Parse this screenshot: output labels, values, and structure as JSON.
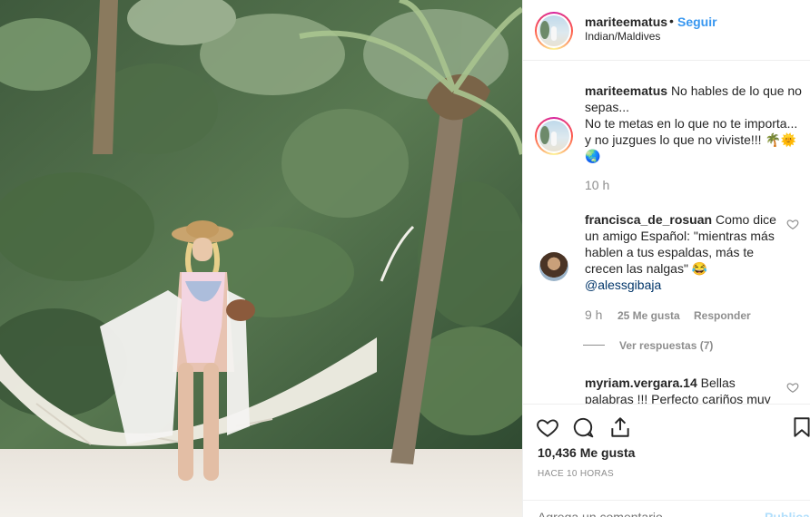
{
  "header": {
    "username": "mariteematus",
    "dot": "•",
    "follow_label": "Seguir",
    "location": "Indian/Maldives"
  },
  "caption": {
    "username": "mariteematus",
    "lines": [
      "No hables de lo que no",
      "sepas...",
      "No te metas en lo que no te importa...",
      "y no juzgues lo que no viviste!!! 🌴🌞",
      "🌏"
    ],
    "time": "10 h"
  },
  "comments": [
    {
      "username": "francisca_de_rosuan",
      "lines": [
        "Como dice",
        "un amigo Español: \"mientras más",
        "hablen a tus espaldas, más te",
        "crecen las nalgas\" 😂"
      ],
      "mention": "@alessgibaja",
      "time": "9 h",
      "likes": "25 Me gusta",
      "reply_label": "Responder",
      "view_replies": "Ver respuestas (7)"
    },
    {
      "username": "myriam.vergara.14",
      "lines": [
        "Bellas",
        "palabras !!! Perfecto cariños muy"
      ]
    }
  ],
  "actions": {
    "likes_count": "10,436 Me gusta",
    "posted_ago": "Hace 10 horas",
    "comment_placeholder": "Agrega un comentario...",
    "publish_label": "Publicar"
  },
  "icons": {
    "like": "heart-icon",
    "comment": "comment-icon",
    "share": "share-icon",
    "save": "bookmark-icon"
  },
  "colors": {
    "link_blue": "#3897f0",
    "publish_disabled": "#b2dffc",
    "muted": "#8e8e8e"
  }
}
